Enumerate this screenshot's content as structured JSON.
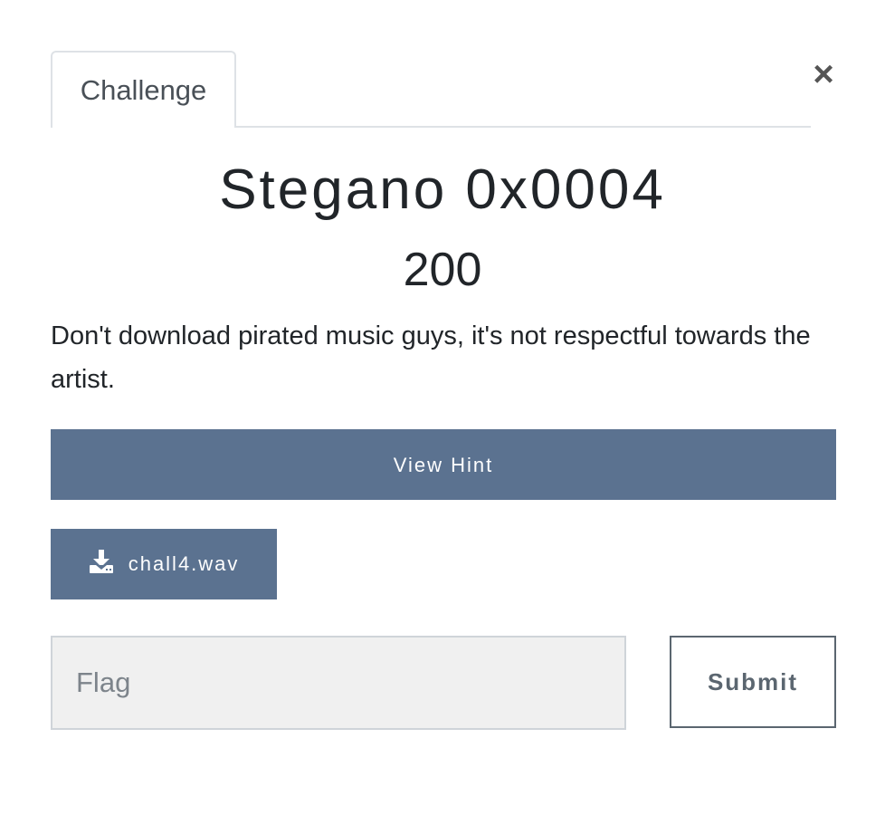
{
  "modal": {
    "close_symbol": "×",
    "tab_label": "Challenge",
    "title": "Stegano 0x0004",
    "points": "200",
    "description": "Don't download pirated music guys, it's not respectful towards the artist.",
    "hint_button_label": "View Hint",
    "file": {
      "icon": "download-icon",
      "name": "chall4.wav"
    },
    "flag_input": {
      "placeholder": "Flag",
      "value": ""
    },
    "submit_label": "Submit"
  },
  "colors": {
    "button_bg": "#5b7290",
    "input_bg": "#f0f0f0",
    "text": "#212529"
  }
}
